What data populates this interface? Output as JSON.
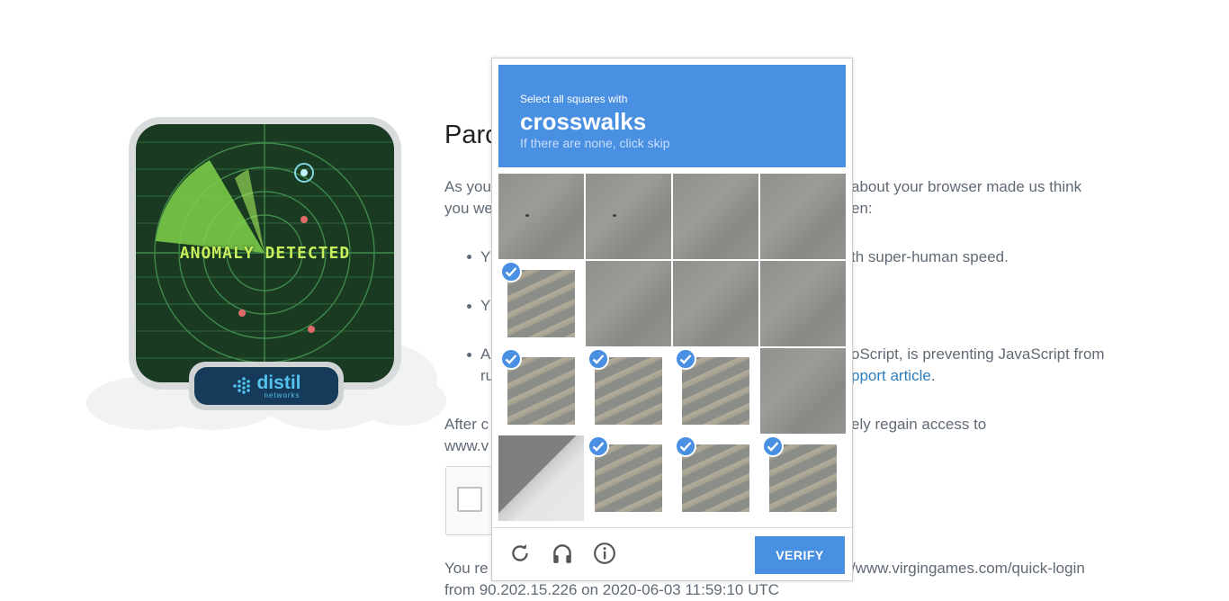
{
  "background_page": {
    "title_fragment": "Parc",
    "para1_line1_left": "As you",
    "para1_line1_right": "about your browser made us think",
    "para1_line2_left": "you we",
    "para1_line2_right": "en:",
    "bullet1_left": "Y",
    "bullet1_right": "th super-human speed.",
    "bullet2_left": "Y",
    "bullet3_line1_left": "A",
    "bullet3_line1_right": "oScript, is preventing JavaScript from",
    "bullet3_line2_left": "ru",
    "bullet3_link": "pport article",
    "bullet3_period": ".",
    "para2_line1_left": "After c",
    "para2_line1_right": "ely regain access to",
    "para2_line2_left": "www.v",
    "para3_line1_left": "You re",
    "para3_line1_right": "/www.virgingames.com/quick-login",
    "para3_line2": "from 90.202.15.226 on 2020-06-03 11:59:10 UTC"
  },
  "illustration": {
    "radar_text": "ANOMALY DETECTED",
    "logo_word": "distil",
    "logo_sub": "networks"
  },
  "captcha": {
    "instruction_small": "Select all squares with",
    "instruction_target": "crosswalks",
    "instruction_skip": "If there are none, click skip",
    "tiles": [
      {
        "selected": false,
        "image": "concrete-spot"
      },
      {
        "selected": false,
        "image": "concrete-spot"
      },
      {
        "selected": false,
        "image": "concrete"
      },
      {
        "selected": false,
        "image": "concrete"
      },
      {
        "selected": true,
        "image": "crosswalk"
      },
      {
        "selected": false,
        "image": "concrete"
      },
      {
        "selected": false,
        "image": "concrete"
      },
      {
        "selected": false,
        "image": "concrete"
      },
      {
        "selected": true,
        "image": "crosswalk"
      },
      {
        "selected": true,
        "image": "crosswalk"
      },
      {
        "selected": true,
        "image": "crosswalk"
      },
      {
        "selected": false,
        "image": "concrete"
      },
      {
        "selected": false,
        "image": "curb-corner"
      },
      {
        "selected": true,
        "image": "crosswalk"
      },
      {
        "selected": true,
        "image": "crosswalk"
      },
      {
        "selected": true,
        "image": "crosswalk"
      }
    ],
    "footer_icons": [
      "reload-icon",
      "audio-headphones-icon",
      "info-icon"
    ],
    "verify_label": "VERIFY",
    "accent_color": "#4a90e2"
  }
}
